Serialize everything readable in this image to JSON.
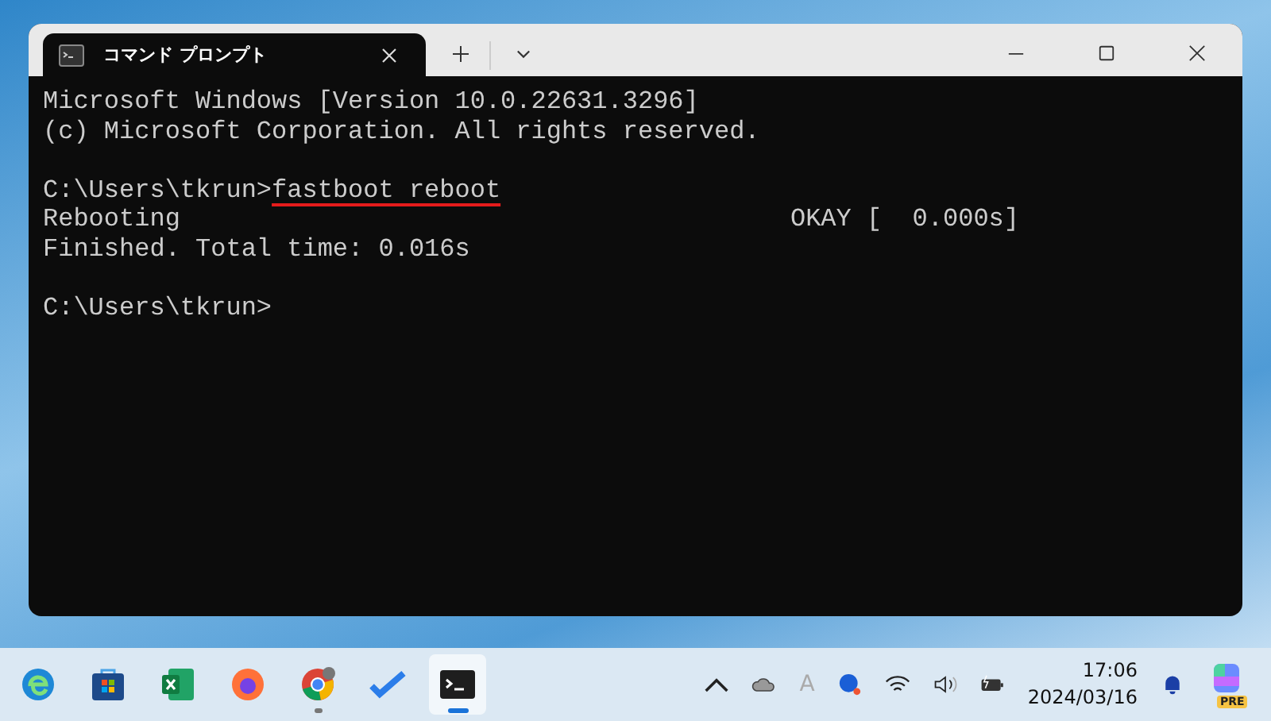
{
  "window": {
    "tab": {
      "title": "コマンド プロンプト",
      "selected": true
    }
  },
  "terminal": {
    "lines": [
      {
        "kind": "output",
        "text": "Microsoft Windows [Version 10.0.22631.3296]"
      },
      {
        "kind": "output",
        "text": "(c) Microsoft Corporation. All rights reserved."
      },
      {
        "kind": "blank"
      },
      {
        "kind": "prompt",
        "prompt": "C:\\Users\\tkrun>",
        "command": "fastboot reboot"
      },
      {
        "kind": "status",
        "text": "Rebooting",
        "status": "OKAY [  0.000s]"
      },
      {
        "kind": "output",
        "text": "Finished. Total time: 0.016s"
      },
      {
        "kind": "blank"
      },
      {
        "kind": "prompt",
        "prompt": "C:\\Users\\tkrun>"
      }
    ]
  },
  "taskbar": {
    "apps": [
      {
        "kind": "edge",
        "selected": false
      },
      {
        "kind": "store",
        "selected": false
      },
      {
        "kind": "excel",
        "selected": false
      },
      {
        "kind": "firefox",
        "selected": false
      },
      {
        "kind": "chrome",
        "selected": false,
        "running": true
      },
      {
        "kind": "todo",
        "selected": false
      },
      {
        "kind": "terminal",
        "selected": true
      }
    ],
    "tray": {
      "ime": "A",
      "time": "17:06",
      "date": "2024/03/16",
      "copilot_badge": "PRE"
    }
  }
}
